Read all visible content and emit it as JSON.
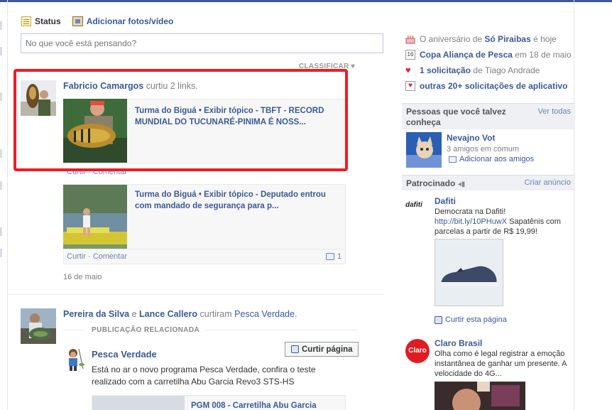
{
  "composer": {
    "tab_status": "Status",
    "tab_photo": "Adicionar fotos/vídeo",
    "placeholder": "No que você está pensando?",
    "sort_label": "CLASSIFICAR ▾"
  },
  "post1": {
    "actor": "Fabricio Camargos",
    "verb": "curtiu 2 links.",
    "link1_title": "Turma do Biguá • Exibir tópico - TBFT - RECORD MUNDIAL DO TUCUNARÉ-PINIMA É NOSS...",
    "link1_actions": "Curtir · Comentar",
    "link2_title": "Turma do Biguá • Exibir tópico - Deputado entrou com mandado de segurança para p...",
    "link2_like": "Curtir",
    "link2_comment": "Comentar",
    "link2_comment_count": "1",
    "timestamp": "16 de maio"
  },
  "post2": {
    "actor1": "Pereira da Silva",
    "conj": "e",
    "actor2": "Lance Callero",
    "verb": "curtiram",
    "page": "Pesca Verdade.",
    "related_label": "PUBLICAÇÃO RELACIONADA",
    "page_name": "Pesca Verdade",
    "like_page_button": "Curtir página",
    "text": "Está no ar o novo programa Pesca Verdade, confira o teste realizado com a carretilha Abu Garcia Revo3 STS-HS",
    "sub_link_title": "PGM 008 - Carretilha Abu Garcia"
  },
  "sidebar": {
    "birthday_prefix": "O aniversário de",
    "birthday_name": "Só Piraibas",
    "birthday_suffix": "é hoje",
    "event_name": "Copa Aliança de Pesca",
    "event_suffix": "em 18 de maio",
    "calendar_day": "16",
    "request_link": "1 solicitação",
    "request_suffix": "de Tiago Andrade",
    "app_requests": "outras 20+ solicitações de aplicativo",
    "pymk_title": "Pessoas que você talvez conheça",
    "pymk_see_all": "Ver todas",
    "pymk_name": "Nevajno Vot",
    "pymk_mutual": "3 amigos em comum",
    "pymk_add": "Adicionar aos amigos",
    "sponsored_title": "Patrocinado",
    "create_ad": "Criar anúncio",
    "ad1_name": "Dafiti",
    "ad1_logo": "dafiti",
    "ad1_line1": "Democrata na Dafiti!",
    "ad1_url": "http://bit.ly/10PHuwX",
    "ad1_line2": "Sapatênis com parcelas a partir de R$ 19,99!",
    "ad1_like": "Curtir esta página",
    "ad2_name": "Claro Brasil",
    "ad2_logo": "Claro",
    "ad2_text": "Olha como é legal registrar a emoção instantânea de ganhar um presente. A velocidade do 4G..."
  },
  "colors": {
    "link": "#3b5998",
    "highlight": "#ee1c24",
    "topbar": "#3b5998"
  }
}
